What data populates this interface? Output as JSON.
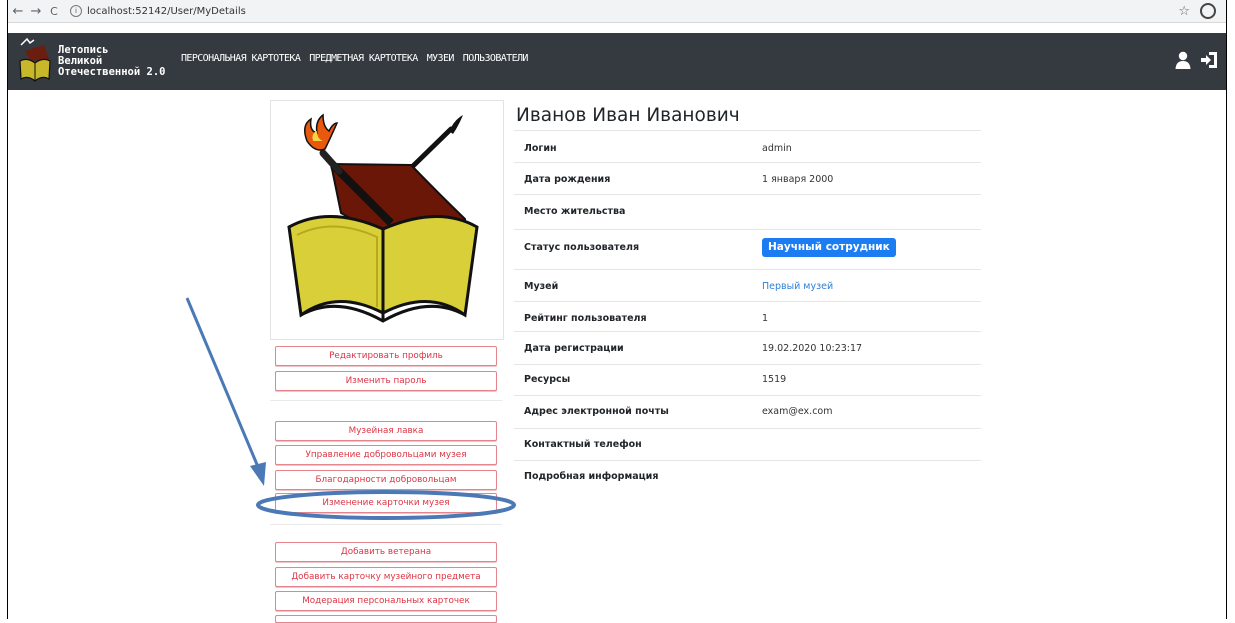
{
  "browser": {
    "back": "←",
    "forward": "→",
    "reload": "C",
    "url": "localhost:52142/User/MyDetails",
    "info": "i",
    "star": "☆"
  },
  "navbar": {
    "brand_lines": [
      "Летопись",
      "Великой",
      "Отечественной 2.0"
    ],
    "menu": [
      "ПЕРСОНАЛЬНАЯ КАРТОТЕКА",
      "ПРЕДМЕТНАЯ КАРТОТЕКА",
      "МУЗЕИ",
      "ПОЛЬЗОВАТЕЛИ"
    ],
    "icons": [
      "user-icon",
      "logout-icon"
    ]
  },
  "profile": {
    "name": "Иванов Иван Иванович",
    "rows": [
      {
        "label": "Логин",
        "value": "admin"
      },
      {
        "label": "Дата рождения",
        "value": "1 января 2000"
      },
      {
        "label": "Место жительства",
        "value": ""
      },
      {
        "label": "Статус пользователя",
        "value": "Научный сотрудник"
      },
      {
        "label": "Музей",
        "value": "Первый музей"
      },
      {
        "label": "Рейтинг пользователя",
        "value": "1"
      },
      {
        "label": "Дата регистрации",
        "value": "19.02.2020 10:23:17"
      },
      {
        "label": "Ресурсы",
        "value": "1519"
      },
      {
        "label": "Адрес электронной почты",
        "value": "exam@ex.com"
      },
      {
        "label": "Контактный телефон",
        "value": ""
      },
      {
        "label": "Подробная информация",
        "value": ""
      }
    ]
  },
  "actions": {
    "profile": [
      "Редактировать профиль",
      "Изменить пароль"
    ],
    "museum": [
      "Музейная лавка",
      "Управление добровольцами музея",
      "Благодарности добровольцам",
      "Изменение карточки музея"
    ],
    "content": [
      "Добавить ветерана",
      "Добавить карточку музейного предмета",
      "Модерация персональных карточек"
    ]
  },
  "colors": {
    "navbar_bg": "#343a40",
    "danger": "#dc3545",
    "badge_bg": "#1c7cf2",
    "link": "#2f80d6",
    "annotation": "#4a79b6"
  }
}
